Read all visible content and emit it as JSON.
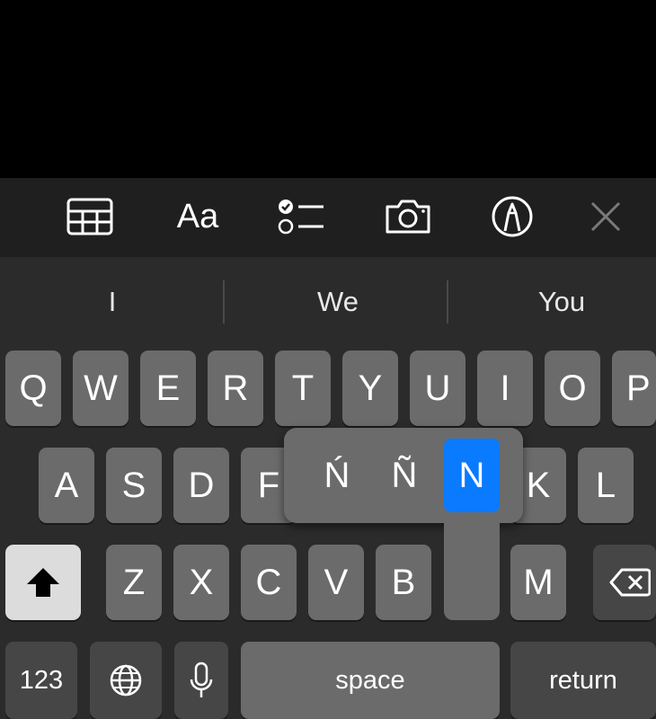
{
  "toolbar": {
    "icons": [
      "table-icon",
      "text-format-icon",
      "checklist-icon",
      "camera-icon",
      "markup-pen-icon",
      "close-icon"
    ],
    "format_label": "Aa"
  },
  "suggestions": [
    "I",
    "We",
    "You"
  ],
  "rows": {
    "row1": [
      "Q",
      "W",
      "E",
      "R",
      "T",
      "Y",
      "U",
      "I",
      "O",
      "P"
    ],
    "row2": [
      "A",
      "S",
      "D",
      "F",
      "K",
      "L"
    ],
    "row3": [
      "Z",
      "X",
      "C",
      "V",
      "B",
      "M"
    ]
  },
  "popup": {
    "options": [
      "Ń",
      "Ñ",
      "N"
    ],
    "selected": "N"
  },
  "bottom": {
    "numbers_label": "123",
    "space_label": "space",
    "return_label": "return"
  },
  "colors": {
    "keyboard_bg": "#2b2b2b",
    "key_bg": "#6b6b6b",
    "selected_accent": "#0a7aff"
  }
}
